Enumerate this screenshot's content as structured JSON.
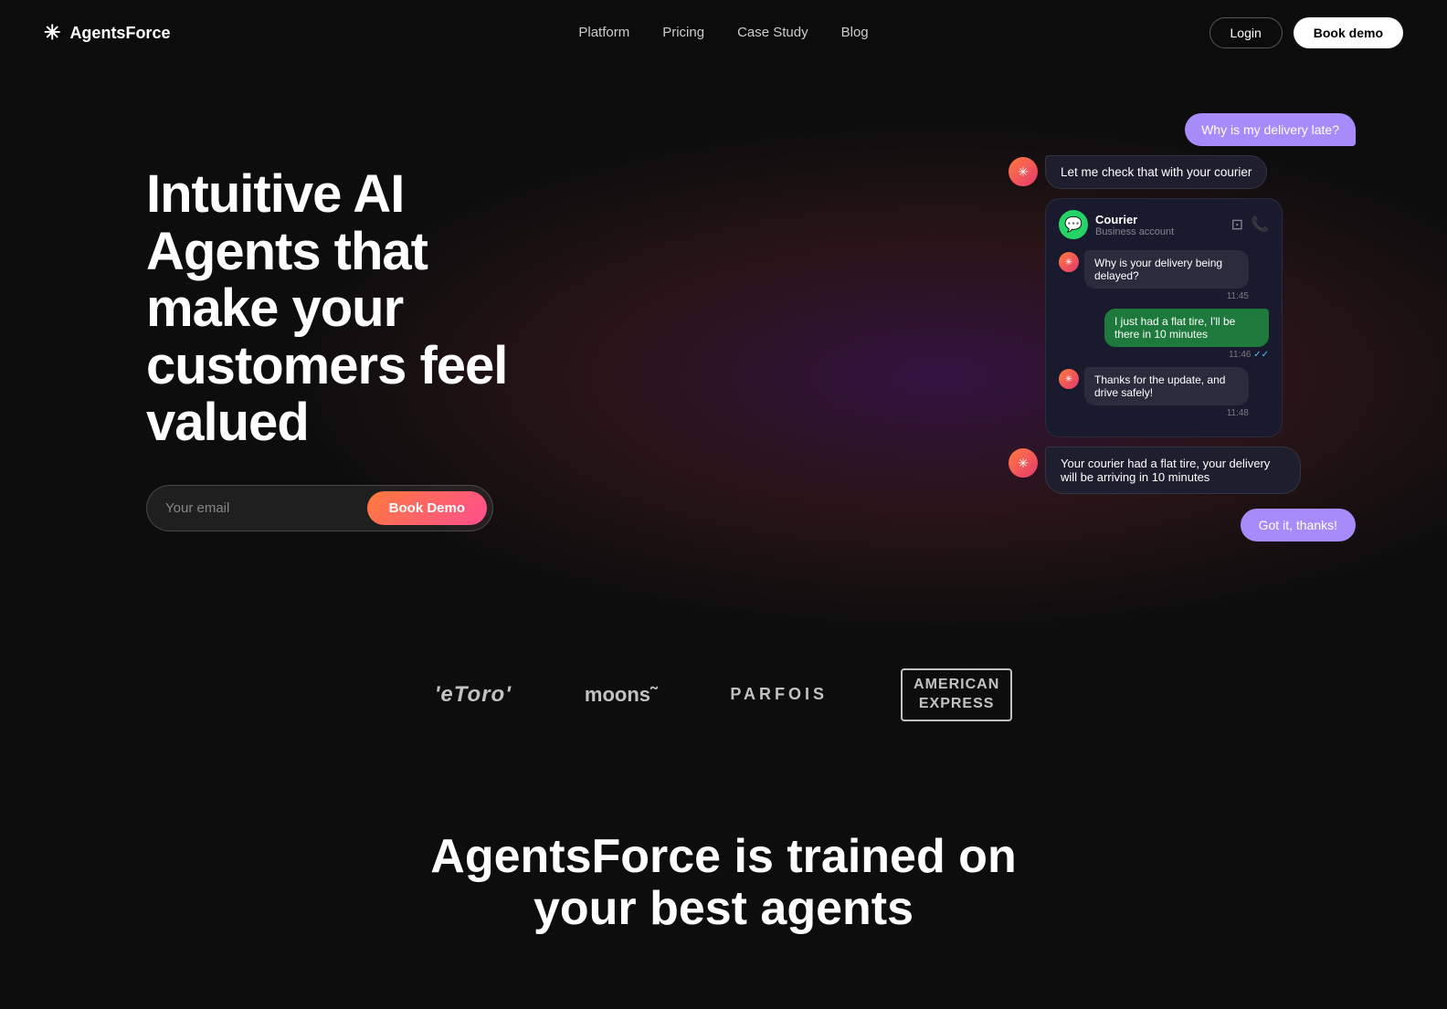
{
  "brand": {
    "name": "AgentsForce",
    "logo_icon": "✳"
  },
  "nav": {
    "links": [
      {
        "id": "platform",
        "label": "Platform"
      },
      {
        "id": "pricing",
        "label": "Pricing"
      },
      {
        "id": "case-study",
        "label": "Case Study"
      },
      {
        "id": "blog",
        "label": "Blog"
      }
    ],
    "login_label": "Login",
    "book_demo_label": "Book demo"
  },
  "hero": {
    "title": "Intuitive AI Agents that make your customers feel valued",
    "email_placeholder": "Your email",
    "book_demo_label": "Book Demo"
  },
  "chat": {
    "user_bubble_1": "Why is my delivery late?",
    "agent_bubble_1": "Let me check that with your courier",
    "whatsapp_name": "Courier",
    "whatsapp_sub": "Business account",
    "msg_q1": "Why is your delivery being delayed?",
    "msg_q1_time": "11:45",
    "msg_a1": "I just had a flat tire, I'll be there in 10 minutes",
    "msg_a1_time": "11:46",
    "msg_a1_ticks": "✓✓",
    "msg_q2": "Thanks for the update, and drive safely!",
    "msg_q2_time": "11:48",
    "agent_bubble_2": "Your courier had a flat tire, your delivery will be arriving in 10 minutes",
    "user_bubble_2": "Got it, thanks!"
  },
  "logos": [
    {
      "id": "etoro",
      "text": "'eToro'",
      "class": "logo-etoro"
    },
    {
      "id": "moons",
      "text": "moons˜",
      "class": "logo-moons"
    },
    {
      "id": "parfois",
      "text": "PARFOIS",
      "class": "logo-parfois"
    },
    {
      "id": "amex",
      "text": "AMERICAN\nEXPRESS",
      "class": "logo-amex"
    }
  ],
  "bottom": {
    "title": "AgentsForce is trained on your best agents"
  }
}
